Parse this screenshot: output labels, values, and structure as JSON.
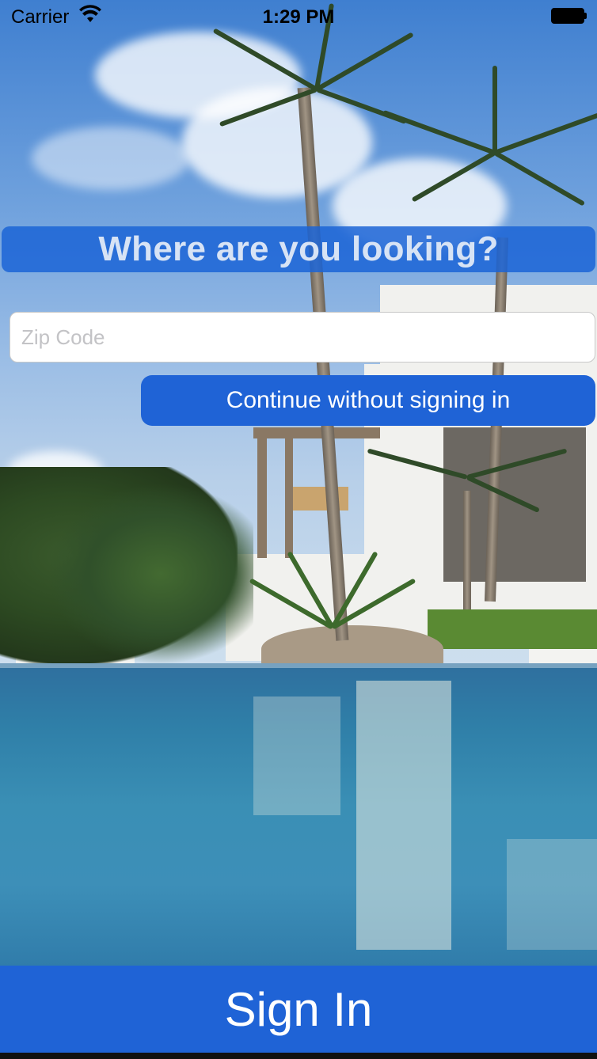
{
  "status_bar": {
    "carrier": "Carrier",
    "time": "1:29 PM",
    "wifi_icon": "wifi-icon",
    "battery_icon": "battery-full-icon"
  },
  "header": {
    "title": "Where are you looking?"
  },
  "search": {
    "placeholder": "Zip Code",
    "value": ""
  },
  "actions": {
    "continue_label": "Continue without signing in",
    "signin_label": "Sign In"
  },
  "colors": {
    "accent_blue": "#1f63d6",
    "banner_blue": "#1b64d6"
  },
  "background": {
    "description_icon": "tropical-house-pool-photo"
  }
}
